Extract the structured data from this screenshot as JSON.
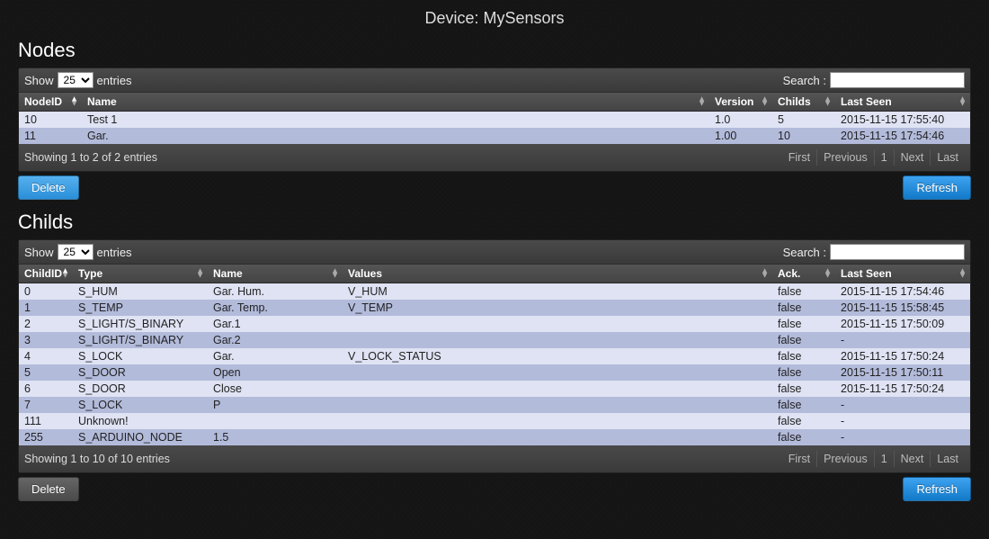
{
  "page_title": "Device: MySensors",
  "nodes": {
    "heading": "Nodes",
    "show_label": "Show",
    "entries_label": "entries",
    "show_value": "25",
    "search_label": "Search :",
    "search_value": "",
    "columns": {
      "c0": "NodeID",
      "c1": "Name",
      "c2": "Version",
      "c3": "Childs",
      "c4": "Last Seen"
    },
    "rows": [
      {
        "id": "10",
        "name": "Test 1",
        "version": "1.0",
        "childs": "5",
        "last": "2015-11-15 17:55:40"
      },
      {
        "id": "11",
        "name": "Gar.",
        "version": "1.00",
        "childs": "10",
        "last": "2015-11-15 17:54:46"
      }
    ],
    "info": "Showing 1 to 2 of 2 entries",
    "pager": {
      "first": "First",
      "prev": "Previous",
      "p1": "1",
      "next": "Next",
      "last": "Last"
    },
    "delete_label": "Delete",
    "refresh_label": "Refresh"
  },
  "childs": {
    "heading": "Childs",
    "show_label": "Show",
    "entries_label": "entries",
    "show_value": "25",
    "search_label": "Search :",
    "search_value": "",
    "columns": {
      "c0": "ChildID",
      "c1": "Type",
      "c2": "Name",
      "c3": "Values",
      "c4": "Ack.",
      "c5": "Last Seen"
    },
    "rows": [
      {
        "id": "0",
        "type": "S_HUM",
        "name": "Gar. Hum.",
        "values": "V_HUM",
        "ack": "false",
        "last": "2015-11-15 17:54:46"
      },
      {
        "id": "1",
        "type": "S_TEMP",
        "name": "Gar. Temp.",
        "values": "V_TEMP",
        "ack": "false",
        "last": "2015-11-15 15:58:45"
      },
      {
        "id": "2",
        "type": "S_LIGHT/S_BINARY",
        "name": "Gar.1",
        "values": "",
        "ack": "false",
        "last": "2015-11-15 17:50:09"
      },
      {
        "id": "3",
        "type": "S_LIGHT/S_BINARY",
        "name": "Gar.2",
        "values": "",
        "ack": "false",
        "last": "-"
      },
      {
        "id": "4",
        "type": "S_LOCK",
        "name": "Gar.",
        "values": "V_LOCK_STATUS",
        "ack": "false",
        "last": "2015-11-15 17:50:24"
      },
      {
        "id": "5",
        "type": "S_DOOR",
        "name": "Open",
        "values": "",
        "ack": "false",
        "last": "2015-11-15 17:50:11"
      },
      {
        "id": "6",
        "type": "S_DOOR",
        "name": "Close",
        "values": "",
        "ack": "false",
        "last": "2015-11-15 17:50:24"
      },
      {
        "id": "7",
        "type": "S_LOCK",
        "name": "P",
        "values": "",
        "ack": "false",
        "last": "-"
      },
      {
        "id": "111",
        "type": "Unknown!",
        "name": "",
        "values": "",
        "ack": "false",
        "last": "-"
      },
      {
        "id": "255",
        "type": "S_ARDUINO_NODE",
        "name": "1.5",
        "values": "",
        "ack": "false",
        "last": "-"
      }
    ],
    "info": "Showing 1 to 10 of 10 entries",
    "pager": {
      "first": "First",
      "prev": "Previous",
      "p1": "1",
      "next": "Next",
      "last": "Last"
    },
    "delete_label": "Delete",
    "refresh_label": "Refresh"
  }
}
